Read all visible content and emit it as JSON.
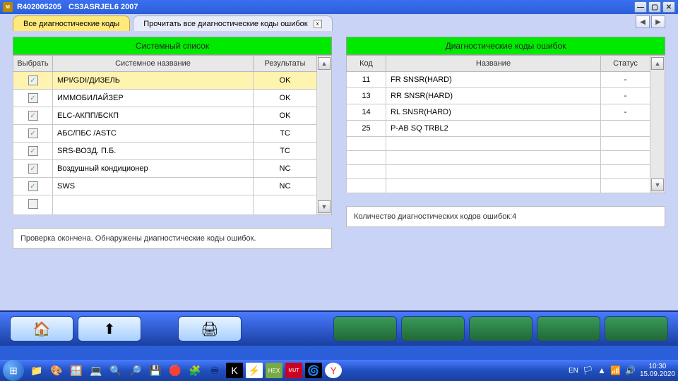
{
  "title": {
    "code": "R402005205",
    "model": "CS3ASRJEL6 2007"
  },
  "tabs": {
    "active": "Все диагностические коды",
    "inactive": "Прочитать все диагностические коды ошибок"
  },
  "left": {
    "header": "Системный список",
    "cols": {
      "select": "Выбрать",
      "name": "Системное название",
      "result": "Результаты"
    },
    "rows": [
      {
        "name": "MPI/GDI/ДИЗЕЛЬ",
        "result": "OK",
        "checked": true,
        "selected": true
      },
      {
        "name": "ИММОБИЛАЙЗЕР",
        "result": "OK",
        "checked": true
      },
      {
        "name": "ELC-АКПП/БСКП",
        "result": "OK",
        "checked": true
      },
      {
        "name": "АБС/ПБС /ASTC",
        "result": "TC",
        "checked": true
      },
      {
        "name": "SRS-ВОЗД. П.Б.",
        "result": "TC",
        "checked": true
      },
      {
        "name": "Воздушный кондиционер",
        "result": "NC",
        "checked": true
      },
      {
        "name": "SWS",
        "result": "NC",
        "checked": true
      },
      {
        "name": "",
        "result": "",
        "checked": false
      }
    ],
    "status": "Проверка окончена. Обнаружены диагностические коды ошибок."
  },
  "right": {
    "header": "Диагностические коды ошибок",
    "cols": {
      "code": "Код",
      "name": "Название",
      "status": "Статус"
    },
    "rows": [
      {
        "code": "11",
        "name": "FR SNSR(HARD)",
        "status": "-"
      },
      {
        "code": "13",
        "name": "RR SNSR(HARD)",
        "status": "-"
      },
      {
        "code": "14",
        "name": "RL SNSR(HARD)",
        "status": "-"
      },
      {
        "code": "25",
        "name": "P-AB SQ TRBL2",
        "status": ""
      },
      {
        "code": "",
        "name": "",
        "status": ""
      },
      {
        "code": "",
        "name": "",
        "status": ""
      },
      {
        "code": "",
        "name": "",
        "status": ""
      },
      {
        "code": "",
        "name": "",
        "status": ""
      }
    ],
    "status": "Количество диагностических кодов ошибок:4"
  },
  "tray": {
    "lang": "EN",
    "time": "10:30",
    "date": "15.09.2020"
  }
}
